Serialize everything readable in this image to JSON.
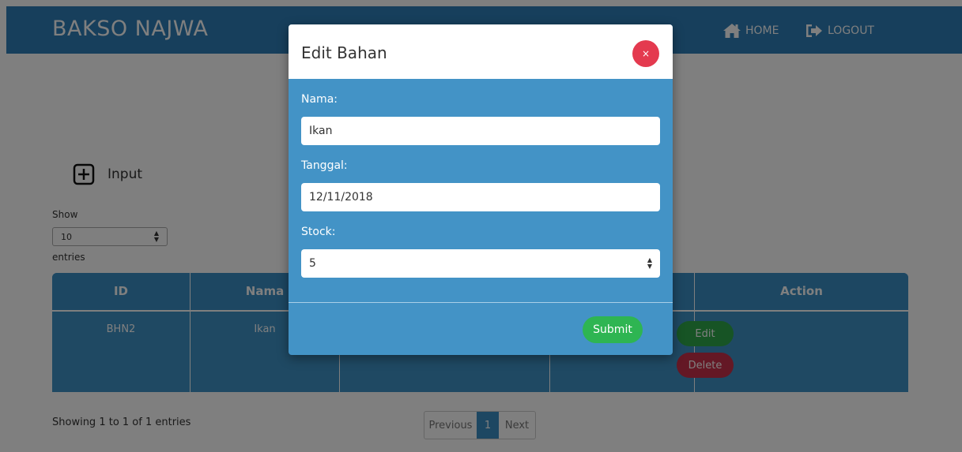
{
  "navbar": {
    "brand": "BAKSO NAJWA",
    "home_label": "HOME",
    "logout_label": "LOGOUT",
    "home_icon": "home-icon",
    "logout_icon": "sign-out-icon"
  },
  "toolbar": {
    "input_label": "Input",
    "input_icon": "plus-square-icon"
  },
  "length_menu": {
    "show_label": "Show",
    "selected": "10",
    "entries_label": "entries"
  },
  "table": {
    "columns": [
      "ID",
      "Nama",
      "",
      "",
      "Action"
    ],
    "rows": [
      {
        "id": "BHN2",
        "nama": "Ikan"
      }
    ],
    "edit_label": "Edit",
    "delete_label": "Delete"
  },
  "footer": {
    "info": "Showing 1 to 1 of 1 entries",
    "prev_label": "Previous",
    "current_page": "1",
    "next_label": "Next"
  },
  "modal": {
    "title": "Edit Bahan",
    "close_label": "×",
    "fields": {
      "nama_label": "Nama:",
      "nama_value": "Ikan",
      "tanggal_label": "Tanggal:",
      "tanggal_value": "12/11/2018",
      "stock_label": "Stock:",
      "stock_value": "5"
    },
    "submit_label": "Submit"
  },
  "colors": {
    "primary": "#2e7fb8",
    "modal_body": "#4393c6",
    "success": "#2eb552",
    "danger": "#e43a4f"
  }
}
